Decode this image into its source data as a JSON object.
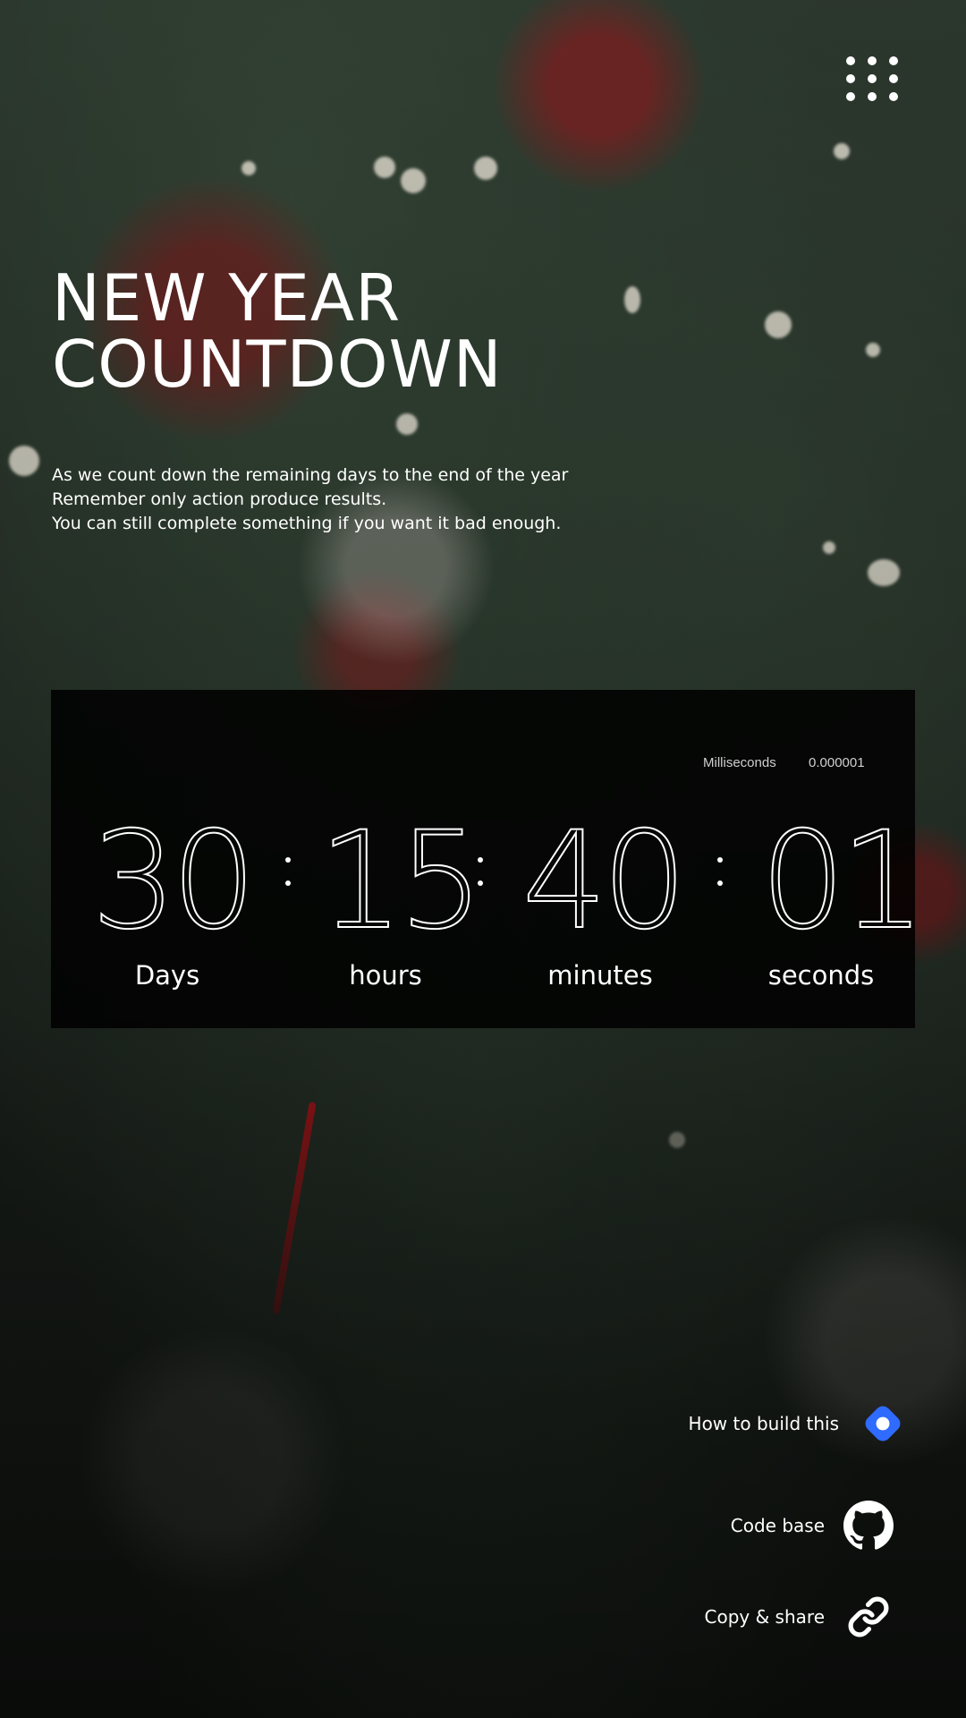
{
  "header": {
    "title_line1": "NEW YEAR",
    "title_line2": "COUNTDOWN",
    "menu_icon": "dots-grid-icon"
  },
  "description": {
    "line1": "As we count down the remaining days to the end of the year",
    "line2": "Remember only action produce results.",
    "line3": "You can still complete something if you want it bad enough."
  },
  "countdown": {
    "milliseconds_label": "Milliseconds",
    "milliseconds_value": "0.000001",
    "days": "30",
    "days_label": "Days",
    "hours": "15",
    "hours_label": "hours",
    "minutes": "40",
    "minutes_label": "minutes",
    "seconds": "01",
    "seconds_label": "seconds"
  },
  "links": [
    {
      "label": "How to build this",
      "icon": "diamond-icon",
      "color": "#2f6bff"
    },
    {
      "label": "Code base",
      "icon": "github-icon"
    },
    {
      "label": "Copy & share",
      "icon": "link-icon"
    }
  ]
}
